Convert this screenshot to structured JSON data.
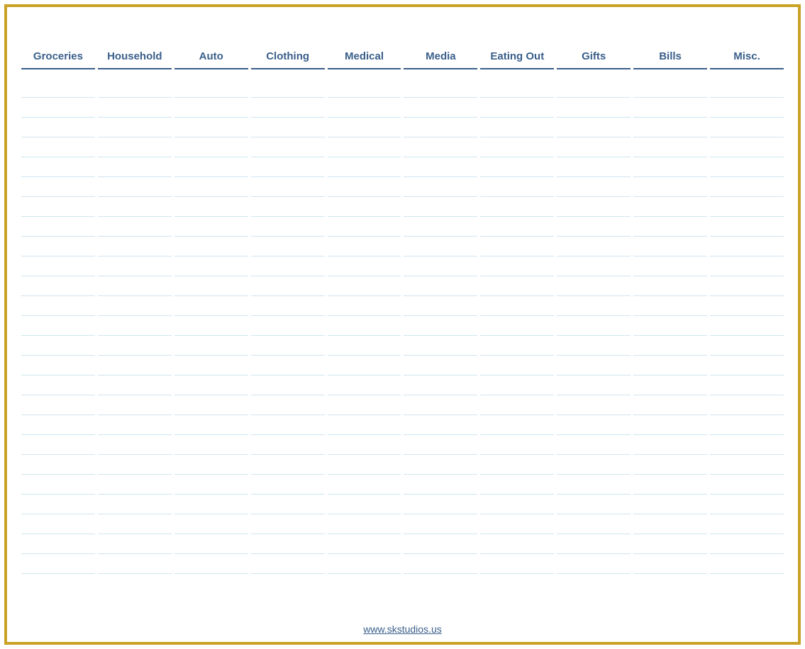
{
  "columns": [
    "Groceries",
    "Household",
    "Auto",
    "Clothing",
    "Medical",
    "Media",
    "Eating Out",
    "Gifts",
    "Bills",
    "Misc."
  ],
  "row_count": 25,
  "footer": {
    "link_text": "www.skstudios.us",
    "link_href": "http://www.skstudios.us"
  },
  "colors": {
    "frame_border": "#c9a227",
    "header_text": "#3a5f8a",
    "row_line": "#cfe5f2"
  }
}
